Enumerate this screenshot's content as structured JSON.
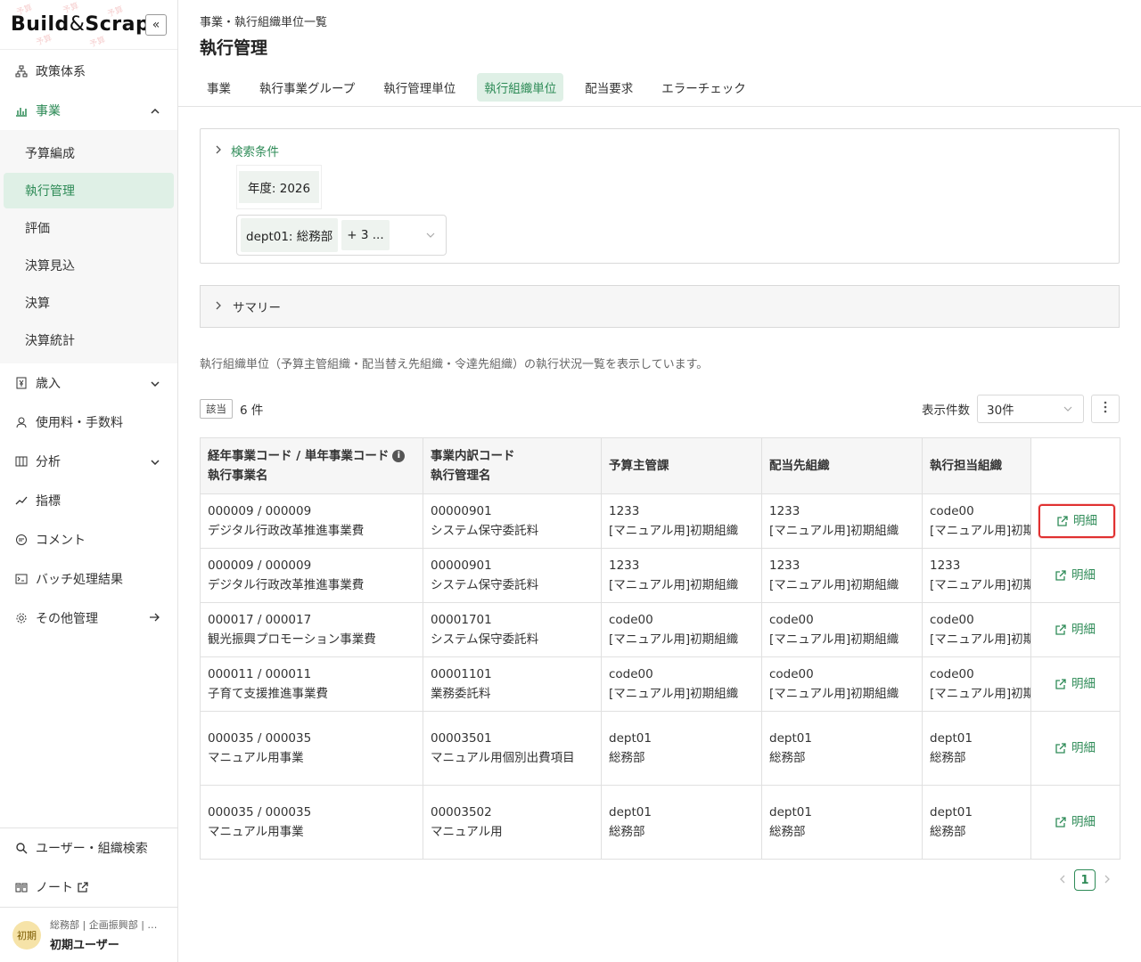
{
  "logo": {
    "part1": "Build",
    "amp": "&",
    "part2": "Scrap",
    "collapse_icon": "double-chevron-left-icon"
  },
  "sidebar": {
    "items": [
      {
        "label": "政策体系",
        "icon": "hierarchy-icon"
      },
      {
        "label": "事業",
        "icon": "bar-chart-icon",
        "expanded": true
      },
      {
        "label": "歳入",
        "icon": "yen-document-icon"
      },
      {
        "label": "使用料・手数料",
        "icon": "coins-icon"
      },
      {
        "label": "分析",
        "icon": "table-icon"
      },
      {
        "label": "指標",
        "icon": "trend-icon"
      },
      {
        "label": "コメント",
        "icon": "comment-icon"
      },
      {
        "label": "バッチ処理結果",
        "icon": "terminal-icon"
      },
      {
        "label": "その他管理",
        "icon": "gear-icon"
      }
    ],
    "sub_items": [
      "予算編成",
      "執行管理",
      "評価",
      "決算見込",
      "決算",
      "決算統計"
    ],
    "active_sub": "執行管理",
    "bottom": [
      {
        "label": "ユーザー・組織検索",
        "icon": "search-icon"
      },
      {
        "label": "ノート",
        "icon": "book-icon"
      }
    ],
    "user": {
      "avatar": "初期",
      "dept": "総務部 | 企画振興部 | 子育て支援部",
      "name": "初期ユーザー"
    }
  },
  "header": {
    "breadcrumb": "事業・執行組織単位一覧",
    "title": "執行管理",
    "tabs": [
      "事業",
      "執行事業グループ",
      "執行管理単位",
      "執行組織単位",
      "配当要求",
      "エラーチェック"
    ],
    "active_tab": "執行組織単位"
  },
  "search": {
    "title": "検索条件",
    "year": "年度: 2026",
    "dept_chip": "dept01: 総務部",
    "more_chip": "+ 3 ..."
  },
  "summary": {
    "title": "サマリー"
  },
  "description": "執行組織単位（予算主管組織・配当替え先組織・令達先組織）の執行状況一覧を表示しています。",
  "toolbar": {
    "badge": "該当",
    "count": "6 件",
    "per_page_label": "表示件数",
    "per_page_value": "30件"
  },
  "table": {
    "headers": {
      "col1_line1": "経年事業コード / 単年事業コード",
      "col1_line2": "執行事業名",
      "col2_line1": "事業内訳コード",
      "col2_line2": "執行管理名",
      "col3": "予算主管課",
      "col4": "配当先組織",
      "col5": "執行担当組織"
    },
    "detail_label": "明細",
    "rows": [
      {
        "c1a": "000009 / 000009",
        "c1b": "デジタル行政改革推進事業費",
        "c2a": "00000901",
        "c2b": "システム保守委託料",
        "c3a": "1233",
        "c3b": "[マニュアル用]初期組織",
        "c4a": "1233",
        "c4b": "[マニュアル用]初期組織",
        "c5a": "code00",
        "c5b": "[マニュアル用]初期組織"
      },
      {
        "c1a": "000009 / 000009",
        "c1b": "デジタル行政改革推進事業費",
        "c2a": "00000901",
        "c2b": "システム保守委託料",
        "c3a": "1233",
        "c3b": "[マニュアル用]初期組織",
        "c4a": "1233",
        "c4b": "[マニュアル用]初期組織",
        "c5a": "1233",
        "c5b": "[マニュアル用]初期組織"
      },
      {
        "c1a": "000017 / 000017",
        "c1b": "観光振興プロモーション事業費",
        "c2a": "00001701",
        "c2b": "システム保守委託料",
        "c3a": "code00",
        "c3b": "[マニュアル用]初期組織",
        "c4a": "code00",
        "c4b": "[マニュアル用]初期組織",
        "c5a": "code00",
        "c5b": "[マニュアル用]初期組織"
      },
      {
        "c1a": "000011 / 000011",
        "c1b": "子育て支援推進事業費",
        "c2a": "00001101",
        "c2b": "業務委託料",
        "c3a": "code00",
        "c3b": "[マニュアル用]初期組織",
        "c4a": "code00",
        "c4b": "[マニュアル用]初期組織",
        "c5a": "code00",
        "c5b": "[マニュアル用]初期組織"
      },
      {
        "c1a": "000035 / 000035",
        "c1b": "マニュアル用事業",
        "c2a": "00003501",
        "c2b": "マニュアル用個別出費項目",
        "c3a": "dept01",
        "c3b": "総務部",
        "c4a": "dept01",
        "c4b": "総務部",
        "c5a": "dept01",
        "c5b": "総務部"
      },
      {
        "c1a": "000035 / 000035",
        "c1b": "マニュアル用事業",
        "c2a": "00003502",
        "c2b": "マニュアル用",
        "c3a": "dept01",
        "c3b": "総務部",
        "c4a": "dept01",
        "c4b": "総務部",
        "c5a": "dept01",
        "c5b": "総務部"
      }
    ]
  },
  "pager": {
    "current": "1"
  },
  "colors": {
    "accent": "#2e8b57",
    "accent_bg": "#dff0e6",
    "highlight": "#e03030"
  }
}
